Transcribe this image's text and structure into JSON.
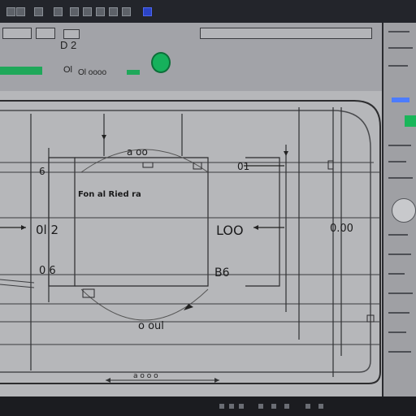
{
  "toolbar": {
    "text_1": "D 2",
    "text_2": "Ol",
    "text_3": "Ol oooo"
  },
  "canvas": {
    "labels": {
      "top_center": "a oo",
      "top_right_o1": "01",
      "left_6": "6",
      "center_text": "Fon al Ried ra",
      "left_02": "0l 2",
      "center_right_loo": "LOO",
      "right_oo": "0.00",
      "left_o6": "0 6",
      "center_right_b6": "B6",
      "bottom_center": "o oul",
      "bottom_small": "a o o o"
    }
  },
  "colors": {
    "accent_green": "#16b15c",
    "accent_blue": "#3f62ff"
  },
  "icons": {
    "toolbar_circle": "circle-icon",
    "titlebar": [
      "window-icon",
      "app-icon",
      "tool-icon",
      "blue-indicator-icon"
    ]
  }
}
